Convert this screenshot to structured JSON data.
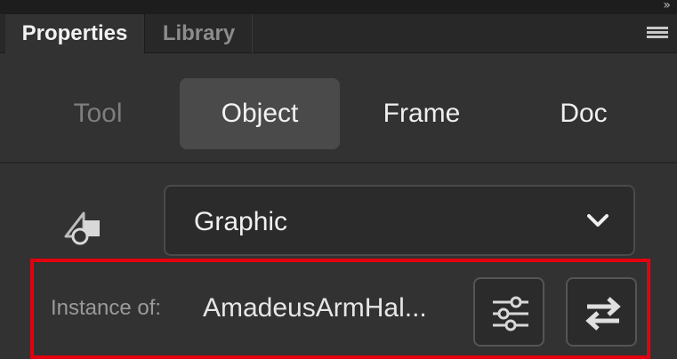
{
  "tabs": {
    "properties": "Properties",
    "library": "Library",
    "collapse_glyph": "»",
    "menu_icon": "panel-menu-icon"
  },
  "modes": {
    "tool": "Tool",
    "object": "Object",
    "frame": "Frame",
    "doc": "Doc",
    "active": "Object"
  },
  "symbol": {
    "type_icon": "symbol-type-icon",
    "type_value": "Graphic",
    "chevron_icon": "chevron-down-icon"
  },
  "instance": {
    "label": "Instance of:",
    "value": "AmadeusArmHal...",
    "properties_button_icon": "sliders-icon",
    "swap_button_icon": "swap-icon"
  },
  "colors": {
    "highlight_border": "#e3000f",
    "panel_bg": "#323232",
    "active_mode_bg": "#4a4a4a"
  }
}
